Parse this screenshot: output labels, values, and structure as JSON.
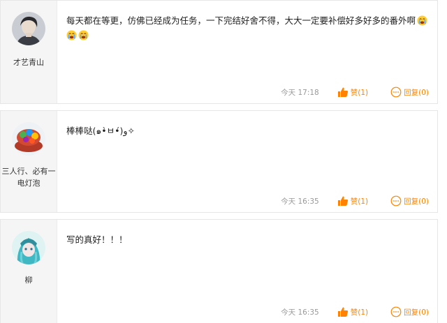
{
  "comments": [
    {
      "username": "才艺青山",
      "text": "每天都在等更，仿佛已经成为任务，一下完结好舍不得，大大一定要补偿好多好多的番外啊",
      "time": "今天 17:18",
      "like_label": "赞(1)",
      "reply_label": "回复(0)",
      "emoji": [
        "crying-face-icon",
        "crying-face-icon",
        "crying-face-icon"
      ]
    },
    {
      "username_line1": "三人行、必有一",
      "username_line2": "电灯泡",
      "text": "棒棒哒(๑•̀ㅂ•́)و✧",
      "time": "今天 16:35",
      "like_label": "赞(1)",
      "reply_label": "回复(0)"
    },
    {
      "username": "柳",
      "text": "写的真好！！！",
      "time": "今天 16:35",
      "like_label": "赞(1)",
      "reply_label": "回复(0)"
    }
  ],
  "colors": {
    "accent": "#ff8200",
    "sidebar": "#f5f5f5",
    "meta": "#999999"
  }
}
